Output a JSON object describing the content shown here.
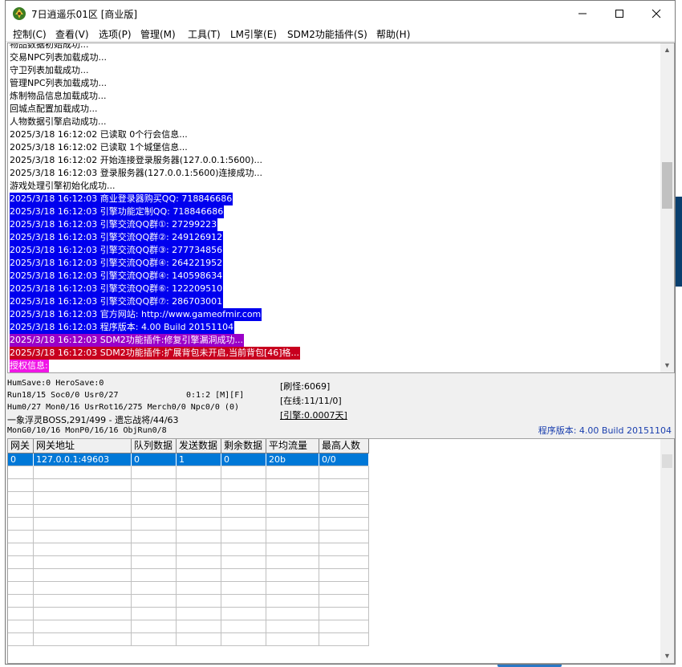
{
  "window": {
    "title": "7日逍遥乐01区 [商业版]",
    "minimize_glyph": "—",
    "maximize_glyph": "☐",
    "close_glyph": "✕"
  },
  "menu": [
    {
      "label": "控制(C)"
    },
    {
      "label": "查看(V)"
    },
    {
      "label": "选项(P)"
    },
    {
      "label": "管理(M)"
    },
    {
      "label": "工具(T)"
    },
    {
      "label": "LM引擎(E)"
    },
    {
      "label": "SDM2功能插件(S)"
    },
    {
      "label": "帮助(H)"
    }
  ],
  "log": [
    {
      "text": "物品数据初始成功...",
      "style": "plain"
    },
    {
      "text": "交易NPC列表加载成功...",
      "style": "plain"
    },
    {
      "text": "守卫列表加载成功...",
      "style": "plain"
    },
    {
      "text": "管理NPC列表加载成功...",
      "style": "plain"
    },
    {
      "text": "炼制物品信息加载成功...",
      "style": "plain"
    },
    {
      "text": "回城点配置加载成功...",
      "style": "plain"
    },
    {
      "text": "人物数据引擎启动成功...",
      "style": "plain"
    },
    {
      "text": "2025/3/18 16:12:02 已读取 0个行会信息...",
      "style": "plain"
    },
    {
      "text": "2025/3/18 16:12:02 已读取 1个城堡信息...",
      "style": "plain"
    },
    {
      "text": "2025/3/18 16:12:02 开始连接登录服务器(127.0.0.1:5600)...",
      "style": "plain"
    },
    {
      "text": "2025/3/18 16:12:03 登录服务器(127.0.0.1:5600)连接成功...",
      "style": "plain"
    },
    {
      "text": "游戏处理引擎初始化成功...",
      "style": "plain"
    },
    {
      "text": "2025/3/18 16:12:03 商业登录器购买QQ: 718846686",
      "style": "blue"
    },
    {
      "text": "2025/3/18 16:12:03 引擎功能定制QQ: 718846686",
      "style": "blue"
    },
    {
      "text": "2025/3/18 16:12:03 引擎交流QQ群①: 27299223",
      "style": "blue"
    },
    {
      "text": "2025/3/18 16:12:03 引擎交流QQ群②: 249126912",
      "style": "blue"
    },
    {
      "text": "2025/3/18 16:12:03 引擎交流QQ群③: 277734856",
      "style": "blue"
    },
    {
      "text": "2025/3/18 16:12:03 引擎交流QQ群④: 264221952",
      "style": "blue"
    },
    {
      "text": "2025/3/18 16:12:03 引擎交流QQ群④: 140598634",
      "style": "blue"
    },
    {
      "text": "2025/3/18 16:12:03 引擎交流QQ群⑥: 122209510",
      "style": "blue"
    },
    {
      "text": "2025/3/18 16:12:03 引擎交流QQ群⑦: 286703001",
      "style": "blue"
    },
    {
      "text": "2025/3/18 16:12:03 官方网站: http://www.gameofmir.com",
      "style": "blue"
    },
    {
      "text": "2025/3/18 16:12:03 程序版本: 4.00 Build 20151104",
      "style": "blue"
    },
    {
      "text": "2025/3/18 16:12:03 SDM2功能插件:修复引擎漏洞成功...",
      "style": "purple"
    },
    {
      "text": "2025/3/18 16:12:03 SDM2功能插件:扩展背包未开启,当前背包[46]格...",
      "style": "red"
    },
    {
      "text": "授权信息:",
      "style": "pink"
    }
  ],
  "status": {
    "line1": "HumSave:0 HeroSave:0",
    "line2": "Run18/15 Soc0/0 Usr0/27",
    "line2_mid": "0:1:2 [M][F]",
    "line3": "Hum0/27 Mon0/16 UsrRot16/275 Merch0/0 Npc0/0 (0)",
    "line4": "一象浮灵BOSS,291/499 - 遗忘战将/44/63",
    "line5": "MonG0/10/16 MonP0/16/16 ObjRun0/8",
    "refresh": "[刷怪:6069]",
    "online": "[在线:11/11/0]",
    "engine": "[引擎:0.0007天]",
    "version": "程序版本: 4.00 Build 20151104"
  },
  "grid": {
    "headers": [
      "网关",
      "网关地址",
      "队列数据",
      "发送数据",
      "剩余数据",
      "平均流量",
      "最高人数"
    ],
    "rows": [
      [
        "0",
        "127.0.0.1:49603",
        "0",
        "1",
        "0",
        "20b",
        "0/0"
      ]
    ]
  },
  "colors": {
    "highlight_blue": "#0000ee",
    "highlight_purple": "#9a00c8",
    "highlight_red": "#c8001e",
    "highlight_pink": "#f015e6",
    "selected_row": "#0078d7",
    "version_text": "#1a3fae"
  },
  "icons": {
    "app": "app-logo-icon",
    "scroll_up": "▲",
    "scroll_down": "▼"
  }
}
